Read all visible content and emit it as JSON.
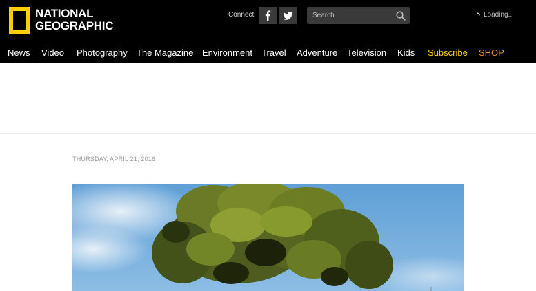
{
  "brand": {
    "line1": "NATIONAL",
    "line2": "GEOGRAPHIC",
    "frame_color": "#ffce00"
  },
  "header": {
    "connect_label": "Connect",
    "social": [
      {
        "icon": "facebook-icon",
        "glyph": "f"
      },
      {
        "icon": "twitter-icon"
      }
    ],
    "search": {
      "placeholder": "Search",
      "value": ""
    },
    "loading_text": "Loading..."
  },
  "nav": {
    "items": [
      {
        "label": "News"
      },
      {
        "label": "Video"
      },
      {
        "label": "Photography"
      },
      {
        "label": "The Magazine"
      },
      {
        "label": "Environment"
      },
      {
        "label": "Travel"
      },
      {
        "label": "Adventure"
      },
      {
        "label": "Television"
      },
      {
        "label": "Kids"
      },
      {
        "label": "Subscribe",
        "color": "#ffce00"
      },
      {
        "label": "SHOP",
        "color": "#f28c28"
      }
    ]
  },
  "article": {
    "date": "THURSDAY, APRIL 21, 2016"
  }
}
